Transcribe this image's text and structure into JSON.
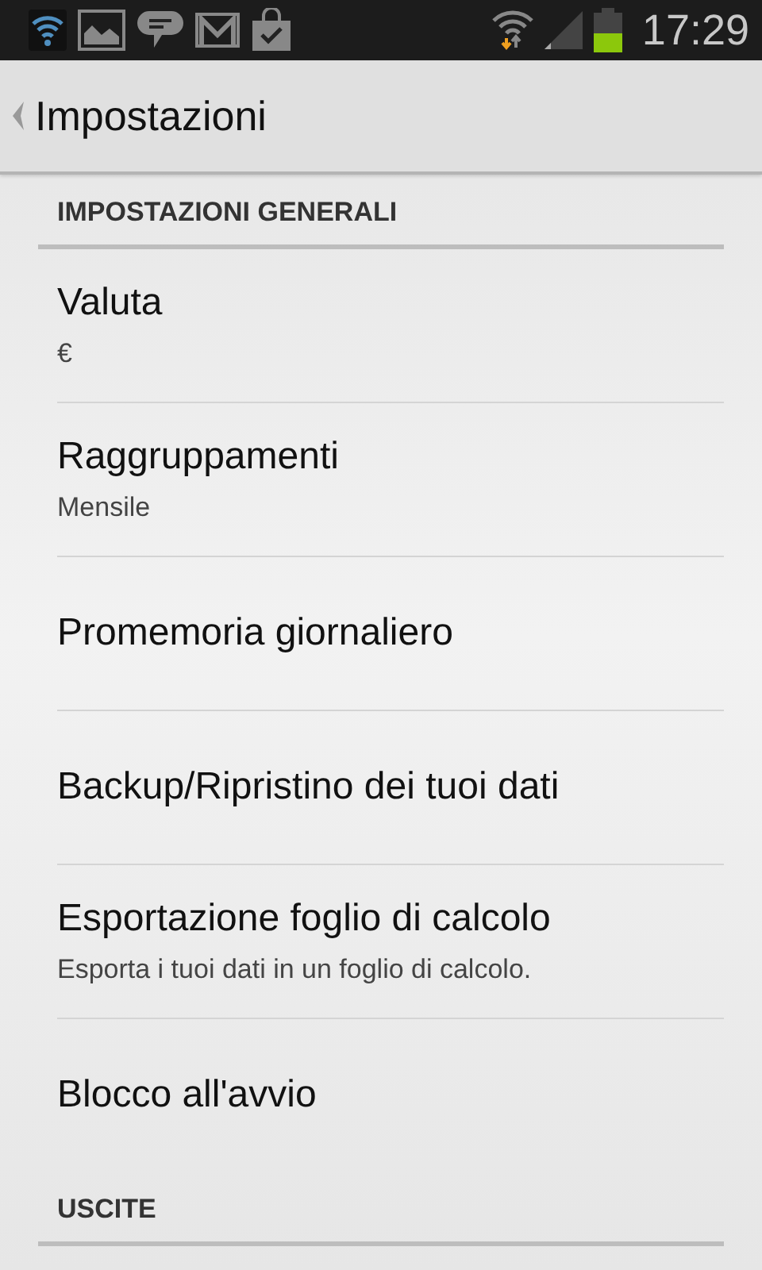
{
  "status_bar": {
    "time": "17:29"
  },
  "action_bar": {
    "title": "Impostazioni"
  },
  "sections": [
    {
      "title": "IMPOSTAZIONI GENERALI",
      "items": [
        {
          "title": "Valuta",
          "summary": "€"
        },
        {
          "title": "Raggruppamenti",
          "summary": "Mensile"
        },
        {
          "title": "Promemoria giornaliero"
        },
        {
          "title": "Backup/Ripristino dei tuoi dati"
        },
        {
          "title": "Esportazione foglio di calcolo",
          "summary": "Esporta i tuoi dati in un foglio di calcolo."
        },
        {
          "title": "Blocco all'avvio"
        }
      ]
    },
    {
      "title": "USCITE"
    }
  ]
}
